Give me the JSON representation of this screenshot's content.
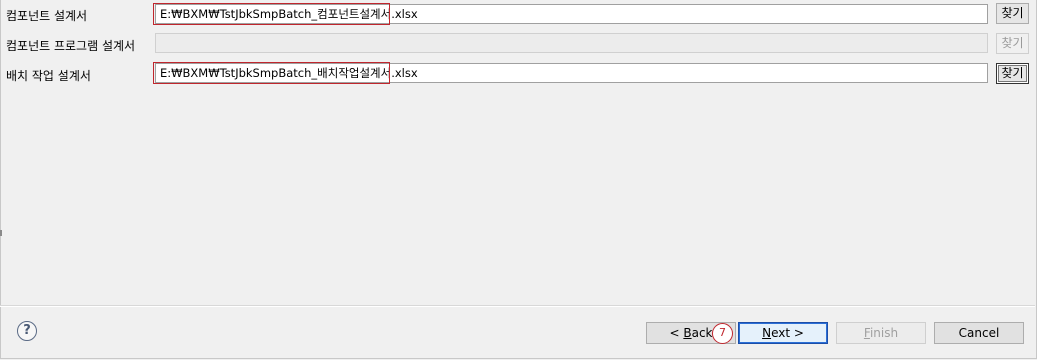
{
  "form": {
    "rows": [
      {
        "label": "컴포넌트 설계서",
        "value": "E:₩BXM₩TstJbkSmpBatch_컴포넌트설계서.xlsx",
        "enabled": true,
        "highlighted": true,
        "button_label": "찾기"
      },
      {
        "label": "컴포넌트 프로그램 설계서",
        "value": "",
        "enabled": false,
        "highlighted": false,
        "button_label": "찾기"
      },
      {
        "label": "배치 작업 설계서",
        "value": "E:₩BXM₩TstJbkSmpBatch_배치작업설계서.xlsx",
        "enabled": true,
        "highlighted": true,
        "button_label": "찾기"
      }
    ]
  },
  "footer": {
    "help_icon": "?",
    "back": {
      "prefix": "< ",
      "mnemonic": "B",
      "rest": "ack"
    },
    "next": {
      "mnemonic": "N",
      "rest": "ext >"
    },
    "finish": {
      "mnemonic": "F",
      "rest": "inish"
    },
    "cancel": {
      "label": "Cancel"
    },
    "step_marker": "7"
  },
  "colors": {
    "annotation": "#c0262d",
    "primary_border": "#1c4ea8",
    "background": "#f0f0f0"
  }
}
